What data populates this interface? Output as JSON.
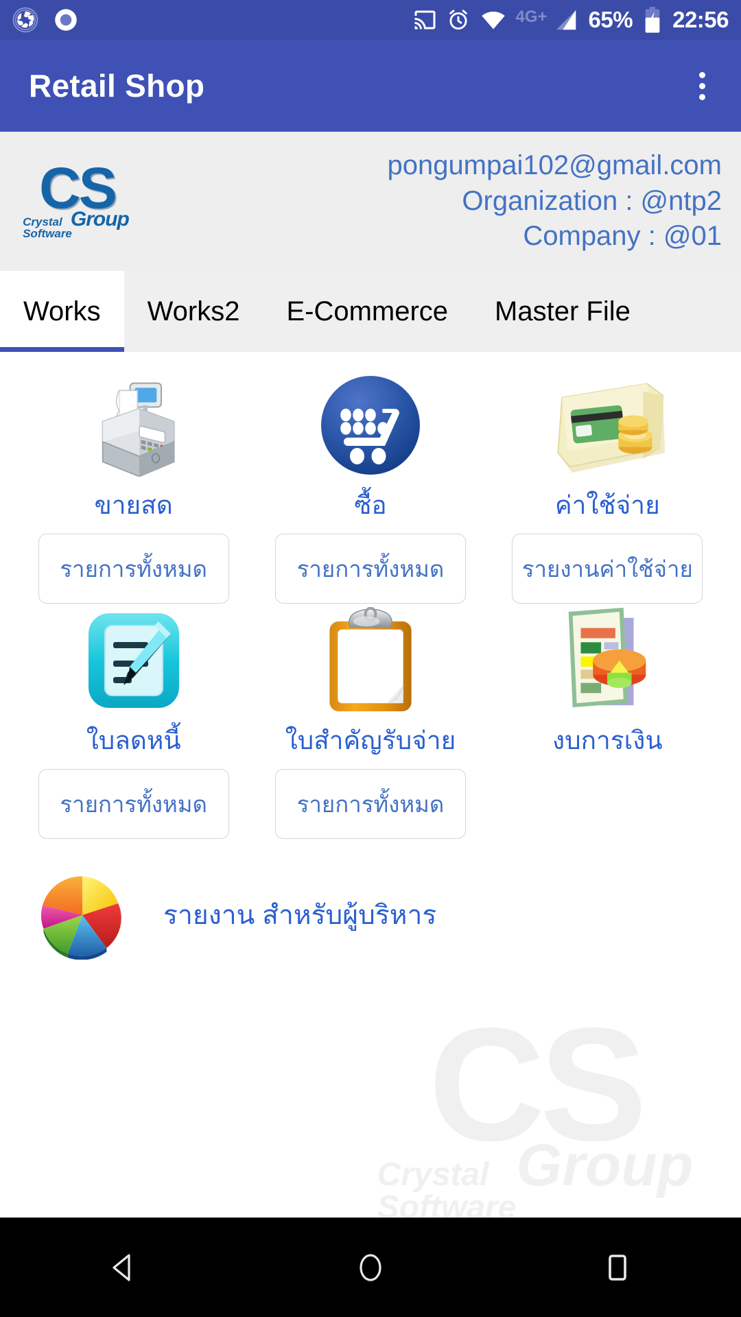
{
  "status_bar": {
    "left_icons": [
      "camera-aperture-icon",
      "screen-record-icon"
    ],
    "right_icons": [
      "cast-icon",
      "alarm-icon",
      "wifi-icon",
      "signal-icon",
      "battery-charging-icon"
    ],
    "network_label": "4G+",
    "battery_percent": "65%",
    "time": "22:56"
  },
  "app_bar": {
    "title": "Retail Shop",
    "overflow_menu": "more-options"
  },
  "account": {
    "logo": {
      "initials": "CS",
      "line1": "Crystal",
      "line2": "Software",
      "word": "Group"
    },
    "email": "pongumpai102@gmail.com",
    "organization": "Organization : @ntp2",
    "company": "Company : @01"
  },
  "tabs": [
    {
      "label": "Works",
      "active": true
    },
    {
      "label": "Works2",
      "active": false
    },
    {
      "label": "E-Commerce",
      "active": false
    },
    {
      "label": "Master File",
      "active": false
    }
  ],
  "grid": [
    {
      "icon": "cash-register-icon",
      "label": "ขายสด",
      "button": "รายการทั้งหมด"
    },
    {
      "icon": "shopping-cart-icon",
      "label": "ซื้อ",
      "button": "รายการทั้งหมด"
    },
    {
      "icon": "wallet-card-coins-icon",
      "label": "ค่าใช้จ่าย",
      "button": "รายงานค่าใช้จ่าย"
    },
    {
      "icon": "notepad-pencil-icon",
      "label": "ใบลดหนี้",
      "button": "รายการทั้งหมด"
    },
    {
      "icon": "clipboard-icon",
      "label": "ใบสำคัญรับจ่าย",
      "button": "รายการทั้งหมด"
    },
    {
      "icon": "financial-report-icon",
      "label": "งบการเงิน",
      "button": ""
    }
  ],
  "exec_report": {
    "icon": "pie-chart-3d-icon",
    "label": "รายงาน สำหรับผู้บริหาร"
  },
  "nav_bar": {
    "back": "back-triangle-icon",
    "home": "home-circle-icon",
    "recents": "recents-square-icon"
  },
  "colors": {
    "status_bar": "#3b4ba8",
    "app_bar": "#3f51b5",
    "account_bg": "#eeeeee",
    "tab_bg": "#efefef",
    "tab_active_bg": "#ffffff",
    "tab_indicator": "#3f51b5",
    "link_blue": "#4472c4",
    "label_blue": "#2a5fd0",
    "logo_blue": "#1565a8",
    "nav_bg": "#000000"
  }
}
